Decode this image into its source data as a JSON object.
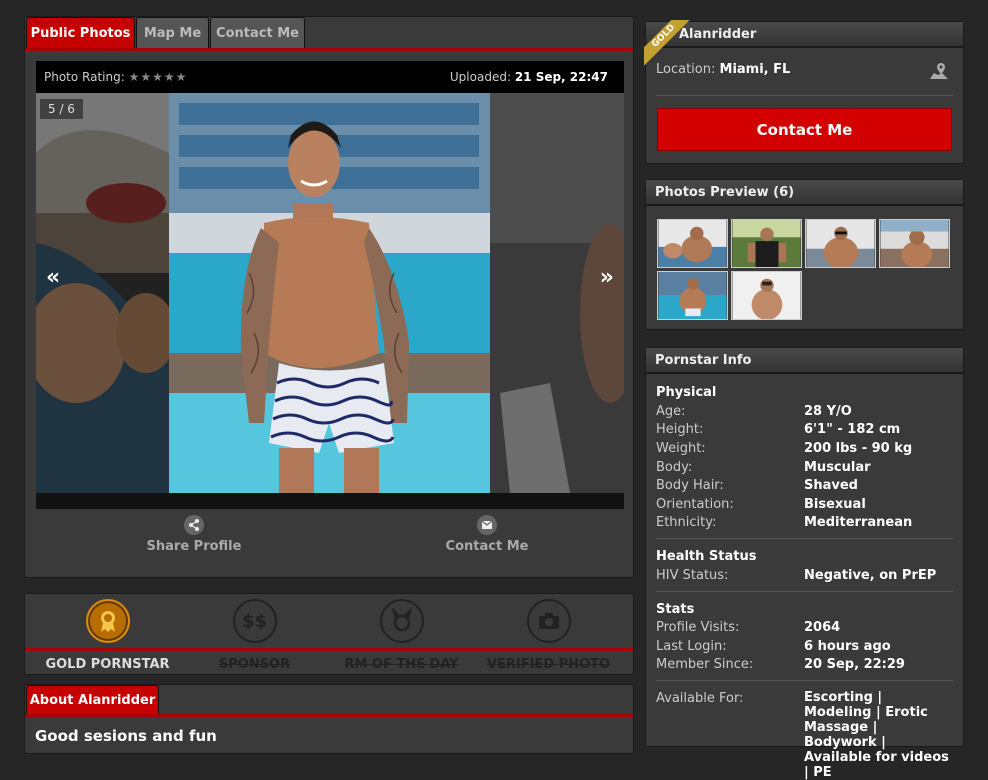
{
  "tabs": {
    "public_photos": "Public Photos",
    "map_me": "Map Me",
    "contact_me": "Contact Me"
  },
  "photo": {
    "rating_label": "Photo Rating:",
    "stars": "★★★★★",
    "uploaded_label": "Uploaded:",
    "uploaded_value": "21 Sep, 22:47",
    "counter": "5 / 6",
    "prev_arrow": "«",
    "next_arrow": "»"
  },
  "actions": {
    "share": "Share Profile",
    "contact": "Contact Me"
  },
  "badges": [
    {
      "label": "GOLD PORNSTAR",
      "active": true,
      "icon": "award-ribbon-icon"
    },
    {
      "label": "SPONSOR",
      "active": false,
      "icon": "dollar-icon"
    },
    {
      "label": "RM OF THE DAY",
      "active": false,
      "icon": "devil-horns-icon"
    },
    {
      "label": "VERIFIED PHOTO",
      "active": false,
      "icon": "camera-icon"
    }
  ],
  "about": {
    "tab": "About Alanridder",
    "text": "Good sesions and fun"
  },
  "profile": {
    "ribbon": "GOLD",
    "name": "Alanridder",
    "location_label": "Location:",
    "location_value": "Miami, FL",
    "contact_button": "Contact Me"
  },
  "preview": {
    "title": "Photos Preview (6)"
  },
  "info": {
    "title": "Pornstar Info",
    "physical": {
      "heading": "Physical",
      "rows": [
        {
          "label": "Age:",
          "value": "28 Y/O"
        },
        {
          "label": "Height:",
          "value": "6'1\" - 182 cm"
        },
        {
          "label": "Weight:",
          "value": "200 lbs - 90 kg"
        },
        {
          "label": "Body:",
          "value": "Muscular"
        },
        {
          "label": "Body Hair:",
          "value": "Shaved"
        },
        {
          "label": "Orientation:",
          "value": "Bisexual"
        },
        {
          "label": "Ethnicity:",
          "value": "Mediterranean"
        }
      ]
    },
    "health": {
      "heading": "Health Status",
      "label": "HIV Status:",
      "value": "Negative, on PrEP"
    },
    "stats": {
      "heading": "Stats",
      "rows": [
        {
          "label": "Profile Visits:",
          "value": "2064"
        },
        {
          "label": "Last Login:",
          "value": "6 hours ago"
        },
        {
          "label": "Member Since:",
          "value": "20 Sep, 22:29"
        }
      ]
    },
    "available": {
      "label": "Available For:",
      "value": "Escorting | Modeling | Erotic Massage | Bodywork | Available for videos | PE"
    }
  }
}
